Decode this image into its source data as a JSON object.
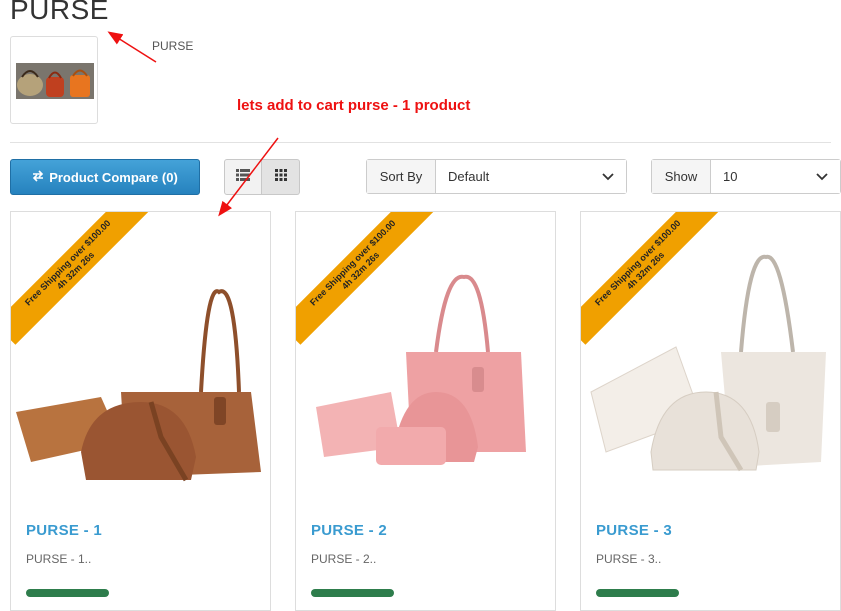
{
  "page": {
    "title": "PURSE",
    "category_caption": "PURSE"
  },
  "annotation": {
    "text": "lets add to cart purse - 1 product",
    "color": "#ee1111"
  },
  "toolbar": {
    "compare_label": "Product Compare (0)",
    "sort_label": "Sort By",
    "sort_value": "Default",
    "show_label": "Show",
    "show_value": "10",
    "icons": [
      "exchange-icon",
      "list-view-icon",
      "grid-view-icon",
      "chevron-down-icon"
    ]
  },
  "products": [
    {
      "name": "PURSE - 1",
      "desc": "PURSE - 1..",
      "ribbon_line1": "Free Shipping over $100.00",
      "ribbon_line2": "4h 32m 26s",
      "bag_color": "#a7623a",
      "accent": "#b8733f"
    },
    {
      "name": "PURSE - 2",
      "desc": "PURSE - 2..",
      "ribbon_line1": "Free Shipping over $100.00",
      "ribbon_line2": "4h 32m 26s",
      "bag_color": "#eea1a3",
      "accent": "#f3b3b4"
    },
    {
      "name": "PURSE - 3",
      "desc": "PURSE - 3..",
      "ribbon_line1": "Free Shipping over $100.00",
      "ribbon_line2": "4h 32m 26s",
      "bag_color": "#ece6df",
      "accent": "#f3eee8"
    }
  ],
  "colors": {
    "ribbon": "#f0a000",
    "link": "#3a9bd0",
    "button": "#2f8ec9",
    "stock_badge": "#2e7d4c"
  }
}
